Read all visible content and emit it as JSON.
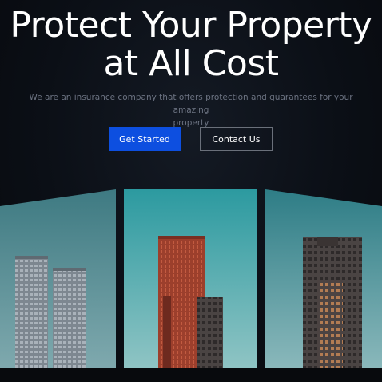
{
  "hero": {
    "title_line1": "Protect Your Property",
    "title_line2": "at All Cost",
    "subtitle_line1": "We are an insurance company that offers protection and guarantees for your amazing",
    "subtitle_line2": "property"
  },
  "buttons": {
    "primary_label": "Get Started",
    "secondary_label": "Contact Us"
  },
  "colors": {
    "primary_button": "#0d4fe0",
    "page_background": "#0b0f16"
  }
}
